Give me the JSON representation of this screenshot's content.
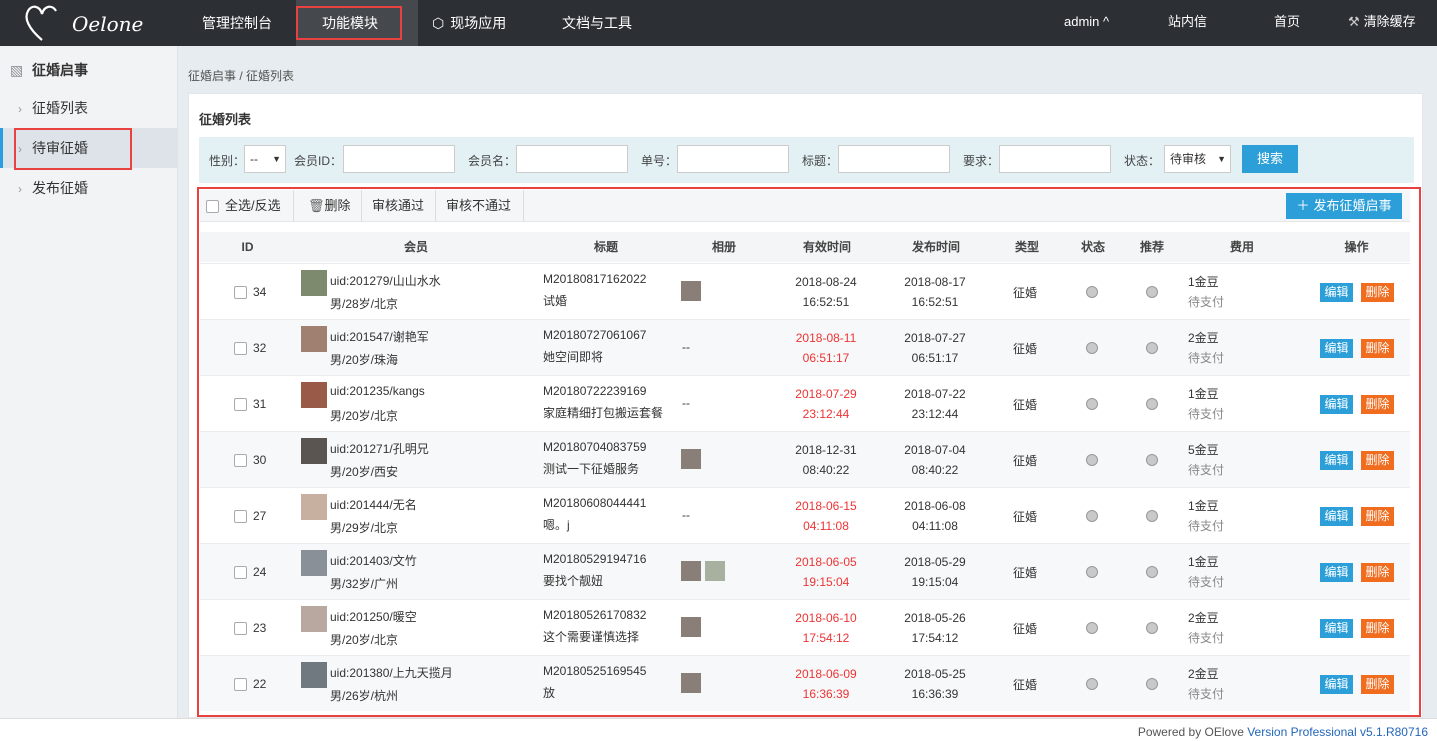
{
  "topbar": {
    "logo_text": "Oelone",
    "nav": [
      "管理控制台",
      "功能模块",
      "现场应用",
      "文档与工具"
    ],
    "user": "admin ^",
    "messages": "站内信",
    "home": "首页",
    "clear_cache": "清除缓存"
  },
  "sidebar": {
    "heading": "征婚启事",
    "items": [
      "征婚列表",
      "待审征婚",
      "发布征婚"
    ]
  },
  "breadcrumb": "征婚启事 / 征婚列表",
  "panel": {
    "title": "征婚列表",
    "search": {
      "gender_label": "性别：",
      "gender_value": "--",
      "member_id_label": "会员ID：",
      "member_name_label": "会员名：",
      "order_no_label": "单号：",
      "title_label": "标题：",
      "requirement_label": "要求：",
      "status_label": "状态：",
      "status_value": "待审核",
      "search_button": "搜索"
    },
    "toolbar": {
      "select_all": "全选/反选",
      "delete": "删除",
      "approve": "审核通过",
      "reject": "审核不通过",
      "publish": "发布征婚启事"
    },
    "columns": [
      "ID",
      "会员",
      "标题",
      "相册",
      "有效时间",
      "发布时间",
      "类型",
      "状态",
      "推荐",
      "费用",
      "操作"
    ],
    "rows": [
      {
        "id": "34",
        "uid": "uid:201279/山山水水",
        "info": "男/28岁/北京",
        "no": "M20180817162022",
        "title": "试婚",
        "photos": 1,
        "valid_date": "2018-08-24",
        "valid_time": "16:52:51",
        "valid_expired": false,
        "pub_date": "2018-08-17",
        "pub_time": "16:52:51",
        "type": "征婚",
        "fee": "1金豆",
        "fee_status": "待支付",
        "edit": "编辑",
        "del": "删除"
      },
      {
        "id": "32",
        "uid": "uid:201547/谢艳军",
        "info": "男/20岁/珠海",
        "no": "M20180727061067",
        "title": "她空间即将",
        "photos": 0,
        "valid_date": "2018-08-11",
        "valid_time": "06:51:17",
        "valid_expired": true,
        "pub_date": "2018-07-27",
        "pub_time": "06:51:17",
        "type": "征婚",
        "fee": "2金豆",
        "fee_status": "待支付",
        "edit": "编辑",
        "del": "删除"
      },
      {
        "id": "31",
        "uid": "uid:201235/kangs",
        "info": "男/20岁/北京",
        "no": "M20180722239169",
        "title": "家庭精细打包搬运套餐",
        "photos": 0,
        "valid_date": "2018-07-29",
        "valid_time": "23:12:44",
        "valid_expired": true,
        "pub_date": "2018-07-22",
        "pub_time": "23:12:44",
        "type": "征婚",
        "fee": "1金豆",
        "fee_status": "待支付",
        "edit": "编辑",
        "del": "删除"
      },
      {
        "id": "30",
        "uid": "uid:201271/孔明兄",
        "info": "男/20岁/西安",
        "no": "M20180704083759",
        "title": "测试一下征婚服务",
        "photos": 1,
        "valid_date": "2018-12-31",
        "valid_time": "08:40:22",
        "valid_expired": false,
        "pub_date": "2018-07-04",
        "pub_time": "08:40:22",
        "type": "征婚",
        "fee": "5金豆",
        "fee_status": "待支付",
        "edit": "编辑",
        "del": "删除"
      },
      {
        "id": "27",
        "uid": "uid:201444/无名",
        "info": "男/29岁/北京",
        "no": "M20180608044441",
        "title": "嗯。j",
        "photos": 0,
        "valid_date": "2018-06-15",
        "valid_time": "04:11:08",
        "valid_expired": true,
        "pub_date": "2018-06-08",
        "pub_time": "04:11:08",
        "type": "征婚",
        "fee": "1金豆",
        "fee_status": "待支付",
        "edit": "编辑",
        "del": "删除"
      },
      {
        "id": "24",
        "uid": "uid:201403/文竹",
        "info": "男/32岁/广州",
        "no": "M20180529194716",
        "title": "要找个靓妞",
        "photos": 2,
        "valid_date": "2018-06-05",
        "valid_time": "19:15:04",
        "valid_expired": true,
        "pub_date": "2018-05-29",
        "pub_time": "19:15:04",
        "type": "征婚",
        "fee": "1金豆",
        "fee_status": "待支付",
        "edit": "编辑",
        "del": "删除"
      },
      {
        "id": "23",
        "uid": "uid:201250/暖空",
        "info": "男/20岁/北京",
        "no": "M20180526170832",
        "title": "这个需要谨慎选择",
        "photos": 1,
        "valid_date": "2018-06-10",
        "valid_time": "17:54:12",
        "valid_expired": true,
        "pub_date": "2018-05-26",
        "pub_time": "17:54:12",
        "type": "征婚",
        "fee": "2金豆",
        "fee_status": "待支付",
        "edit": "编辑",
        "del": "删除"
      },
      {
        "id": "22",
        "uid": "uid:201380/上九天揽月",
        "info": "男/26岁/杭州",
        "no": "M20180525169545",
        "title": "放",
        "photos": 1,
        "valid_date": "2018-06-09",
        "valid_time": "16:36:39",
        "valid_expired": true,
        "pub_date": "2018-05-25",
        "pub_time": "16:36:39",
        "type": "征婚",
        "fee": "2金豆",
        "fee_status": "待支付",
        "edit": "编辑",
        "del": "删除"
      }
    ],
    "empty_album": "--"
  },
  "footer": {
    "powered": "Powered by OElove ",
    "version": "Version Professional v5.1.R80716"
  },
  "colors": {
    "accent": "#2d9fd8",
    "danger": "#f06c1f",
    "expired": "#e33333",
    "highlight": "#e8413f"
  }
}
